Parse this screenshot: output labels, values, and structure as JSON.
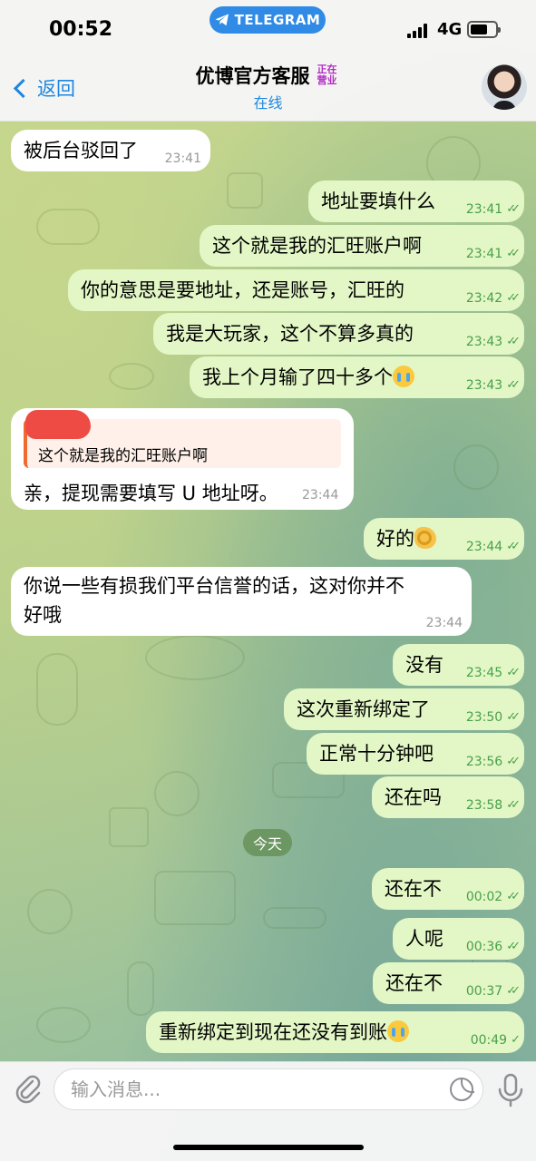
{
  "status_bar": {
    "time": "00:52",
    "pill": "TELEGRAM",
    "network": "4G"
  },
  "header": {
    "back_label": "返回",
    "title": "优博官方客服",
    "tag": "正在营业",
    "status": "在线"
  },
  "messages": [
    {
      "dir": "in",
      "text": "被后台驳回了",
      "time": "23:41"
    },
    {
      "dir": "out",
      "text": "地址要填什么",
      "time": "23:41"
    },
    {
      "dir": "out",
      "text": "这个就是我的汇旺账户啊",
      "time": "23:41"
    },
    {
      "dir": "out",
      "text": "你的意思是要地址，还是账号，汇旺的",
      "time": "23:42"
    },
    {
      "dir": "out",
      "text": "我是大玩家，这个不算多真的",
      "time": "23:43"
    },
    {
      "dir": "out",
      "text": "我上个月输了四十多个",
      "emoji": "crying-face",
      "time": "23:43"
    },
    {
      "dir": "in",
      "quote": "这个就是我的汇旺账户啊",
      "text": "亲，提现需要填写 U 地址呀。",
      "time": "23:44"
    },
    {
      "dir": "out",
      "text": "好的",
      "emoji": "ok-hand",
      "time": "23:44"
    },
    {
      "dir": "in",
      "text_line1": "你说一些有损我们平台信誉的话，这对你并不",
      "text_line2": "好哦",
      "time": "23:44"
    },
    {
      "dir": "out",
      "text": "没有",
      "time": "23:45"
    },
    {
      "dir": "out",
      "text": "这次重新绑定了",
      "time": "23:50"
    },
    {
      "dir": "out",
      "text": "正常十分钟吧",
      "time": "23:56"
    },
    {
      "dir": "out",
      "text": "还在吗",
      "time": "23:58"
    },
    {
      "dir": "out",
      "text": "还在不",
      "time": "00:02"
    },
    {
      "dir": "out",
      "text": "人呢",
      "time": "00:36"
    },
    {
      "dir": "out",
      "text": "还在不",
      "time": "00:37"
    },
    {
      "dir": "out",
      "text": "重新绑定到现在还没有到账",
      "emoji": "crying-face",
      "time": "00:49"
    }
  ],
  "date_separator": "今天",
  "composer": {
    "placeholder": "输入消息..."
  },
  "icons": [
    "telegram-icon",
    "signal-icon",
    "battery-icon",
    "back-chevron-icon",
    "avatar",
    "attach-icon",
    "sticker-icon",
    "mic-icon",
    "read-check-icon"
  ],
  "colors": {
    "accent": "#1e86e0",
    "outgoing_bubble": "#e3f7c6",
    "incoming_bubble": "#ffffff",
    "read_checks": "#48a04a",
    "tag": "#b12bc4"
  }
}
